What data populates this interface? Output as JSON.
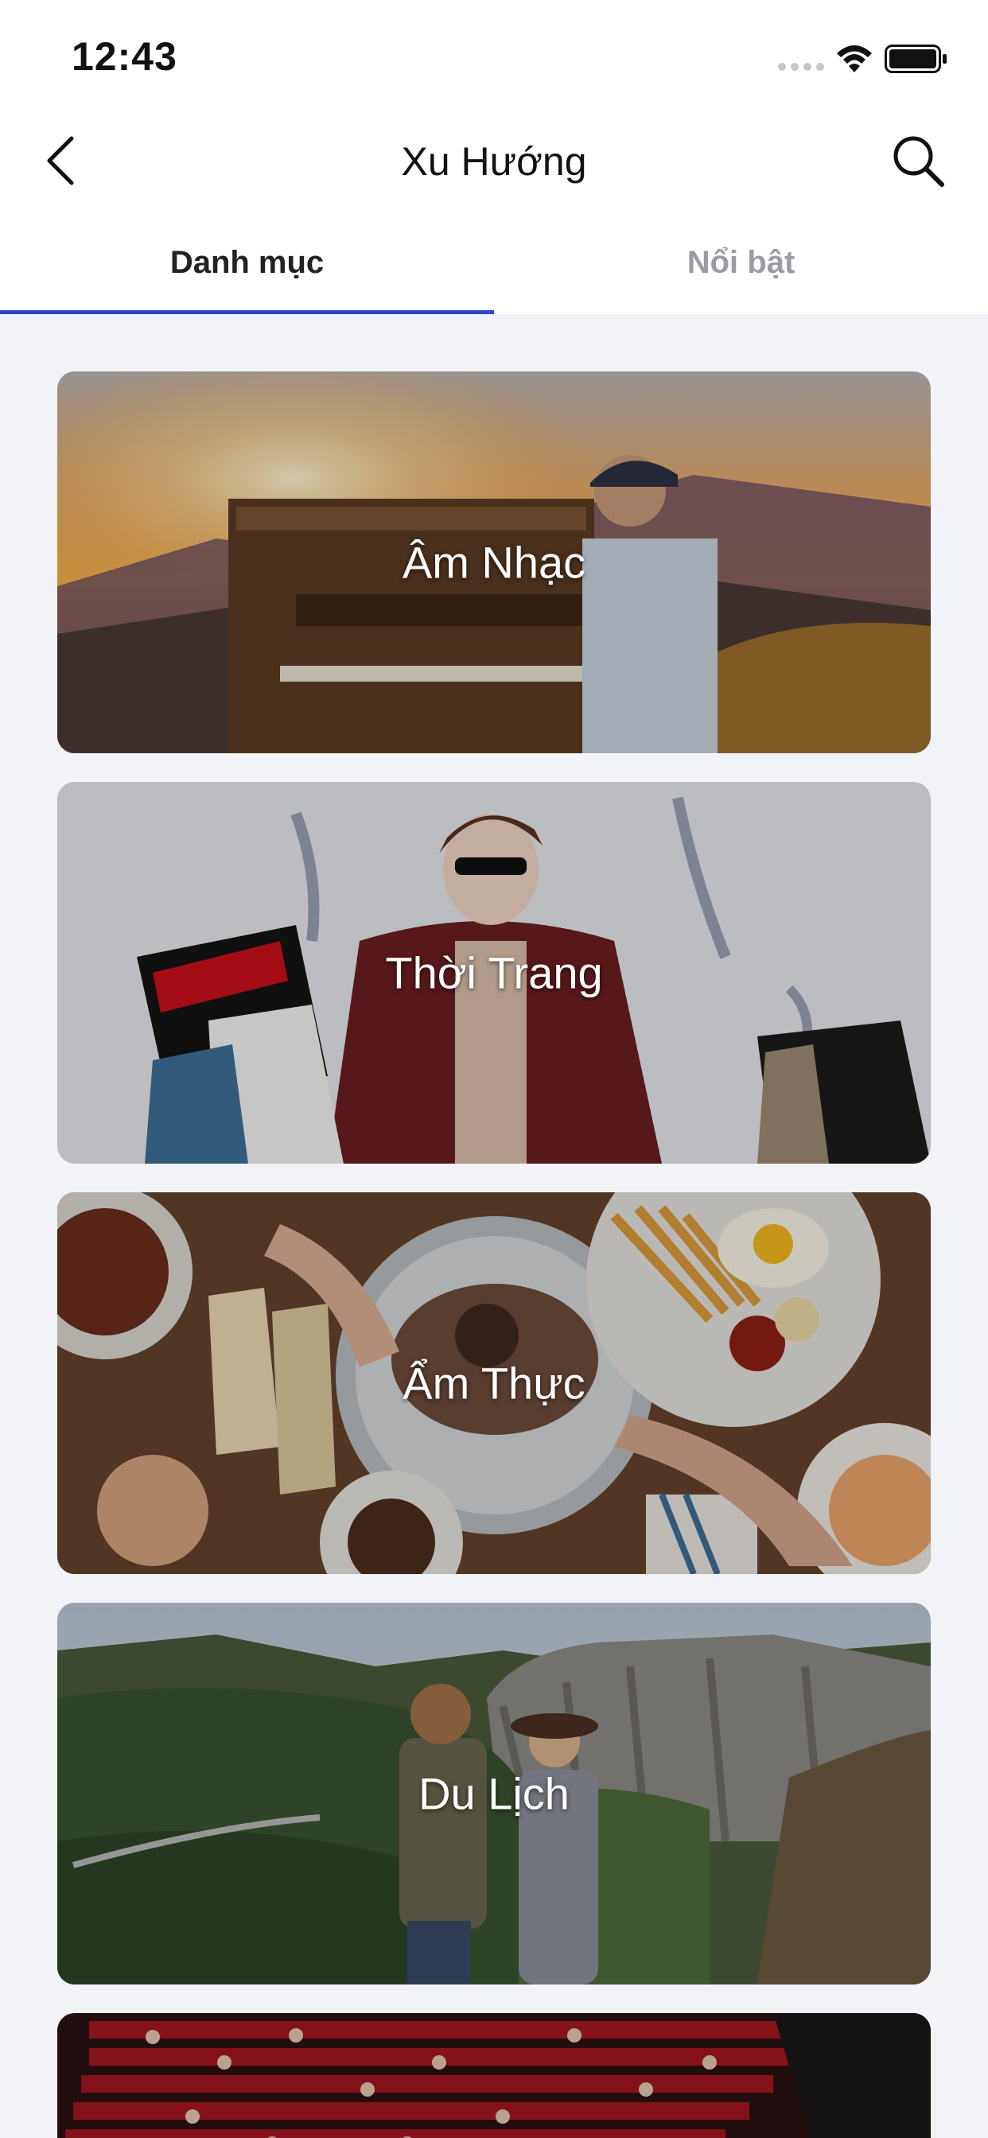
{
  "status_bar": {
    "time": "12:43"
  },
  "nav": {
    "title": "Xu Hướng",
    "back_icon": "chevron-left-icon",
    "search_icon": "search-icon"
  },
  "tabs": [
    {
      "label": "Danh mục",
      "active": true
    },
    {
      "label": "Nổi bật",
      "active": false
    }
  ],
  "colors": {
    "accent": "#2f47c8",
    "inactive_tab": "#9a9ca3",
    "background": "#f2f3f7"
  },
  "categories": [
    {
      "label": "Âm Nhạc"
    },
    {
      "label": "Thời Trang"
    },
    {
      "label": "Ẩm Thực"
    },
    {
      "label": "Du Lịch"
    },
    {
      "label": ""
    }
  ]
}
